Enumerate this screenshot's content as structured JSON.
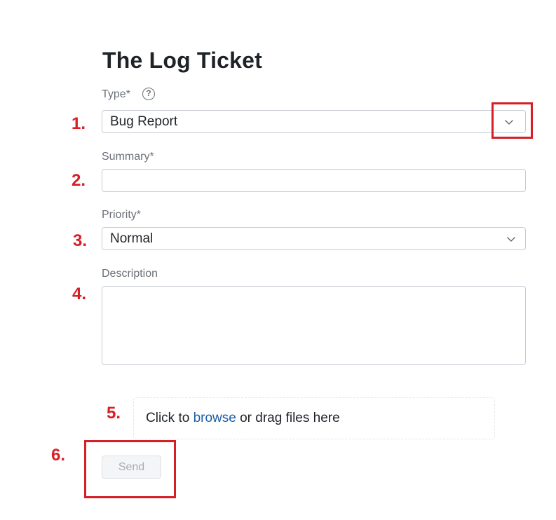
{
  "form": {
    "title": "The Log Ticket",
    "type": {
      "label": "Type*",
      "help_icon": "?",
      "selected": "Bug Report"
    },
    "summary": {
      "label": "Summary*",
      "value": ""
    },
    "priority": {
      "label": "Priority*",
      "selected": "Normal"
    },
    "description": {
      "label": "Description",
      "value": ""
    },
    "attachments": {
      "prefix": "Click to ",
      "link": "browse",
      "suffix": " or drag files here"
    },
    "send_label": "Send"
  },
  "annotations": {
    "steps": [
      "1.",
      "2.",
      "3.",
      "4.",
      "5.",
      "6."
    ],
    "highlight_color": "#d61f26"
  },
  "icons": {
    "help": "question-circle-icon",
    "dropdown": "chevron-down-icon"
  },
  "colors": {
    "link": "#1f5fa6",
    "label": "#6b7077",
    "border": "#c7ccd3"
  }
}
